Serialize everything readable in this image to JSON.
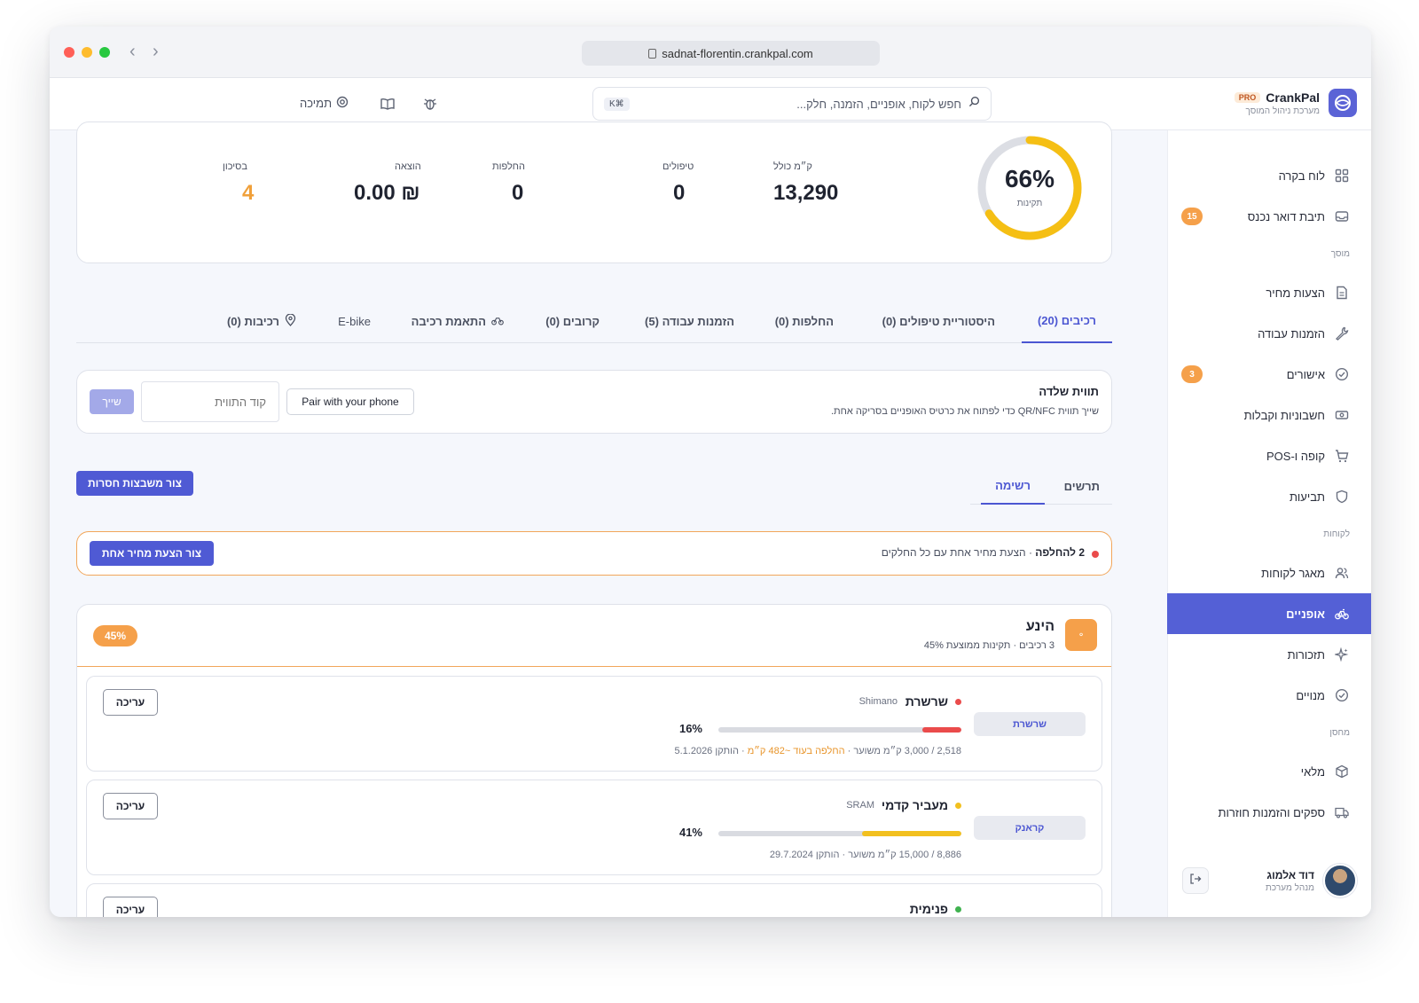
{
  "browser": {
    "url": "sadnat-florentin.crankpal.com"
  },
  "header": {
    "brand_name": "CrankPal",
    "pro_badge": "PRO",
    "brand_sub": "מערכת ניהול המוסך",
    "search_placeholder": "חפש לקוח, אופניים, הזמנה, חלק...",
    "search_shortcut": "⌘K",
    "support_label": "תמיכה"
  },
  "sidebar": {
    "items": [
      {
        "label": "לוח בקרה",
        "icon": "dashboard-icon"
      },
      {
        "label": "תיבת דואר נכנס",
        "icon": "inbox-icon",
        "badge": "15"
      },
      {
        "label": "הצעות מחיר",
        "icon": "document-icon"
      },
      {
        "label": "הזמנות עבודה",
        "icon": "wrench-icon"
      },
      {
        "label": "אישורים",
        "icon": "check-circle-icon",
        "badge": "3"
      },
      {
        "label": "חשבוניות וקבלות",
        "icon": "cash-icon"
      },
      {
        "label": "קופה ו-POS",
        "icon": "cart-icon"
      },
      {
        "label": "תביעות",
        "icon": "shield-icon"
      },
      {
        "label": "מאגר לקוחות",
        "icon": "users-icon"
      },
      {
        "label": "אופניים",
        "icon": "bike-icon",
        "active": true
      },
      {
        "label": "תזכורות",
        "icon": "sparkle-icon"
      },
      {
        "label": "מנויים",
        "icon": "check-circle-icon"
      },
      {
        "label": "מלאי",
        "icon": "box-icon"
      },
      {
        "label": "ספקים והזמנות חוזרות",
        "icon": "truck-icon"
      }
    ],
    "sections": {
      "garage": "מוסך",
      "customers": "לקוחות",
      "warehouse": "מחסן"
    },
    "user": {
      "name": "דוד אלמוג",
      "role": "מנהל מערכת"
    }
  },
  "stats": {
    "gauge_value": "66%",
    "gauge_fraction": 0.66,
    "gauge_label": "תקינות",
    "items": [
      {
        "label": "ק״מ כולל",
        "value": "13,290"
      },
      {
        "label": "טיפולים",
        "value": "0"
      },
      {
        "label": "החלפות",
        "value": "0"
      },
      {
        "label": "הוצאה",
        "value": "₪ 0.00"
      },
      {
        "label": "בסיכון",
        "value": "4"
      }
    ]
  },
  "tabs": [
    {
      "label": "רכיבים (20)",
      "active": true
    },
    {
      "label": "היסטוריית טיפולים (0)"
    },
    {
      "label": "החלפות (0)"
    },
    {
      "label": "הזמנות עבודה (5)"
    },
    {
      "label": "קרובים (0)"
    },
    {
      "label": "התאמת רכיבה"
    },
    {
      "label": "E-bike"
    },
    {
      "label": "רכיבות (0)"
    }
  ],
  "tag": {
    "title": "תווית שלדה",
    "desc": "שייך תווית QR/NFC כדי לפתוח את כרטיס האופניים בסריקה אחת.",
    "pair_button": "Pair with your phone",
    "code_placeholder": "קוד התווית",
    "assign_button": "שייך"
  },
  "view": {
    "tabs": [
      {
        "label": "תרשים"
      },
      {
        "label": "רשימה",
        "active": true
      }
    ],
    "missing_button": "צור משבצות חסרות"
  },
  "alert": {
    "count_text": "2 להחלפה",
    "separator": " · ",
    "detail": "הצעת מחיר אחת עם כל החלקים",
    "button": "צור הצעת מחיר אחת"
  },
  "group": {
    "title": "הינע",
    "subtitle": "3 רכיבים · תקינות ממוצעת 45%",
    "badge": "45%",
    "icon_glyph": "⚬",
    "components": [
      {
        "chip": "שרשרת",
        "name": "שרשרת",
        "brand": "Shimano",
        "dot_color": "#ea4b4b",
        "bar_color": "#ea4b4b",
        "percent": "16%",
        "fill_fraction": 0.16,
        "meta": "2,518 / 3,000 ק״מ משוער · ",
        "meta_warn": "החלפה בעוד ~482 ק״מ",
        "meta_tail": " · הותקן 5.1.2026",
        "edit": "עריכה"
      },
      {
        "chip": "קראנק",
        "name": "מעביר קדמי",
        "brand": "SRAM",
        "dot_color": "#f2c01f",
        "bar_color": "#f2c01f",
        "percent": "41%",
        "fill_fraction": 0.41,
        "meta": "8,886 / 15,000 ק״מ משוער · הותקן 29.7.2024",
        "meta_warn": "",
        "meta_tail": "",
        "edit": "עריכה"
      },
      {
        "chip": "",
        "name": "פנימית",
        "brand": "",
        "dot_color": "#3fb24f",
        "bar_color": "#3fb24f",
        "percent": "",
        "fill_fraction": 0,
        "meta": "",
        "meta_warn": "",
        "meta_tail": "",
        "edit": "עריכה"
      }
    ]
  }
}
